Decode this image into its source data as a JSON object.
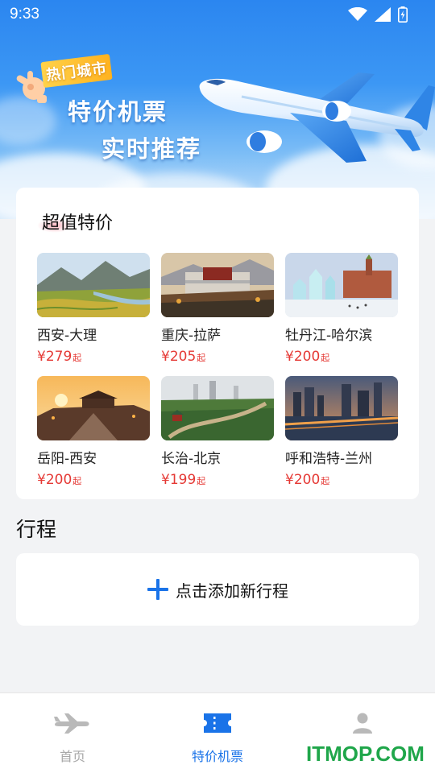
{
  "status_bar": {
    "time": "9:33"
  },
  "hero": {
    "badge": "热门城市",
    "title_line1": "特价机票",
    "title_line2": "实时推荐"
  },
  "deals": {
    "title": "超值特价",
    "items": [
      {
        "route": "西安-大理",
        "price": "¥279",
        "suffix": "起"
      },
      {
        "route": "重庆-拉萨",
        "price": "¥205",
        "suffix": "起"
      },
      {
        "route": "牡丹江-哈尔滨",
        "price": "¥200",
        "suffix": "起"
      },
      {
        "route": "岳阳-西安",
        "price": "¥200",
        "suffix": "起"
      },
      {
        "route": "长治-北京",
        "price": "¥199",
        "suffix": "起"
      },
      {
        "route": "呼和浩特-兰州",
        "price": "¥200",
        "suffix": "起"
      }
    ]
  },
  "itinerary": {
    "title": "行程",
    "add_label": "点击添加新行程"
  },
  "bottom_nav": {
    "items": [
      {
        "label": "首页",
        "icon": "airplane-icon",
        "active": false
      },
      {
        "label": "特价机票",
        "icon": "ticket-icon",
        "active": true
      },
      {
        "label": "",
        "icon": "user-icon",
        "active": false
      }
    ]
  },
  "watermark": "ITMOP.COM",
  "colors": {
    "accent": "#1a73e8",
    "price": "#e53935",
    "inactive": "#a8a8a8",
    "watermark": "#1fa64a"
  }
}
